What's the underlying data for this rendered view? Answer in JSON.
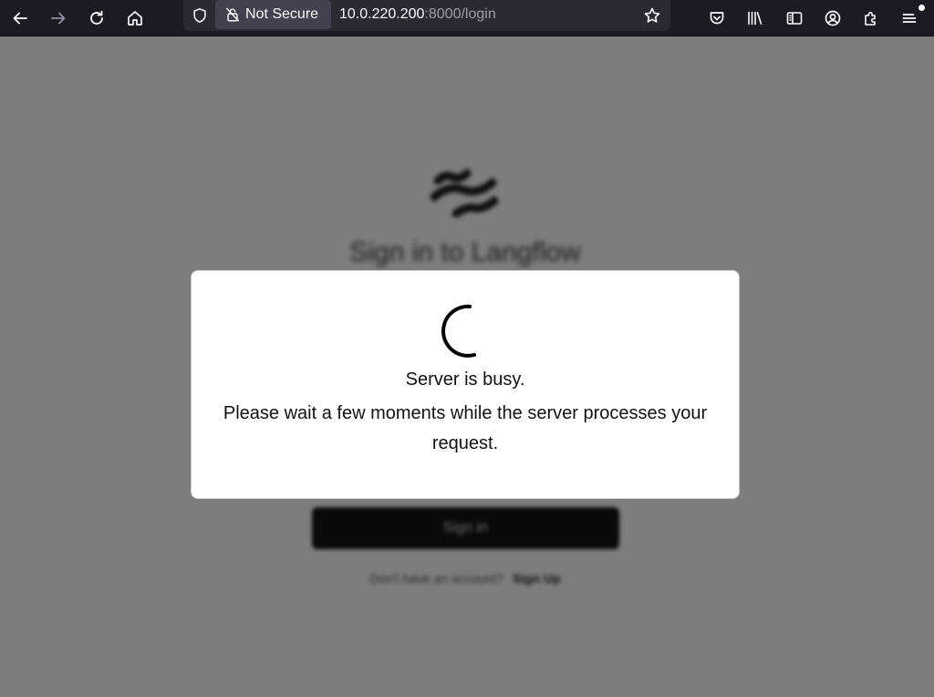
{
  "browser": {
    "security_label": "Not Secure",
    "url_host": "10.0.220.200",
    "url_rest": ":8000/login",
    "icons": [
      "back-arrow-icon",
      "forward-arrow-icon",
      "reload-icon",
      "home-icon",
      "shield-icon",
      "lock-slash-icon",
      "bookmark-star-icon",
      "pocket-icon",
      "library-icon",
      "sidebar-icon",
      "account-icon",
      "extensions-icon",
      "hamburger-menu-icon"
    ]
  },
  "login_page": {
    "title": "Sign in to Langflow",
    "sign_in_button": "Sign in",
    "signup_question": "Don't have an account?",
    "signup_link": "Sign Up"
  },
  "modal": {
    "title": "Server is busy.",
    "message": "Please wait a few moments while the server processes your request."
  },
  "colors": {
    "toolbar_bg": "#1c1b22",
    "urlbar_bg": "#2b2a33",
    "overlay": "#7d7d7d",
    "modal_bg": "#ffffff"
  }
}
